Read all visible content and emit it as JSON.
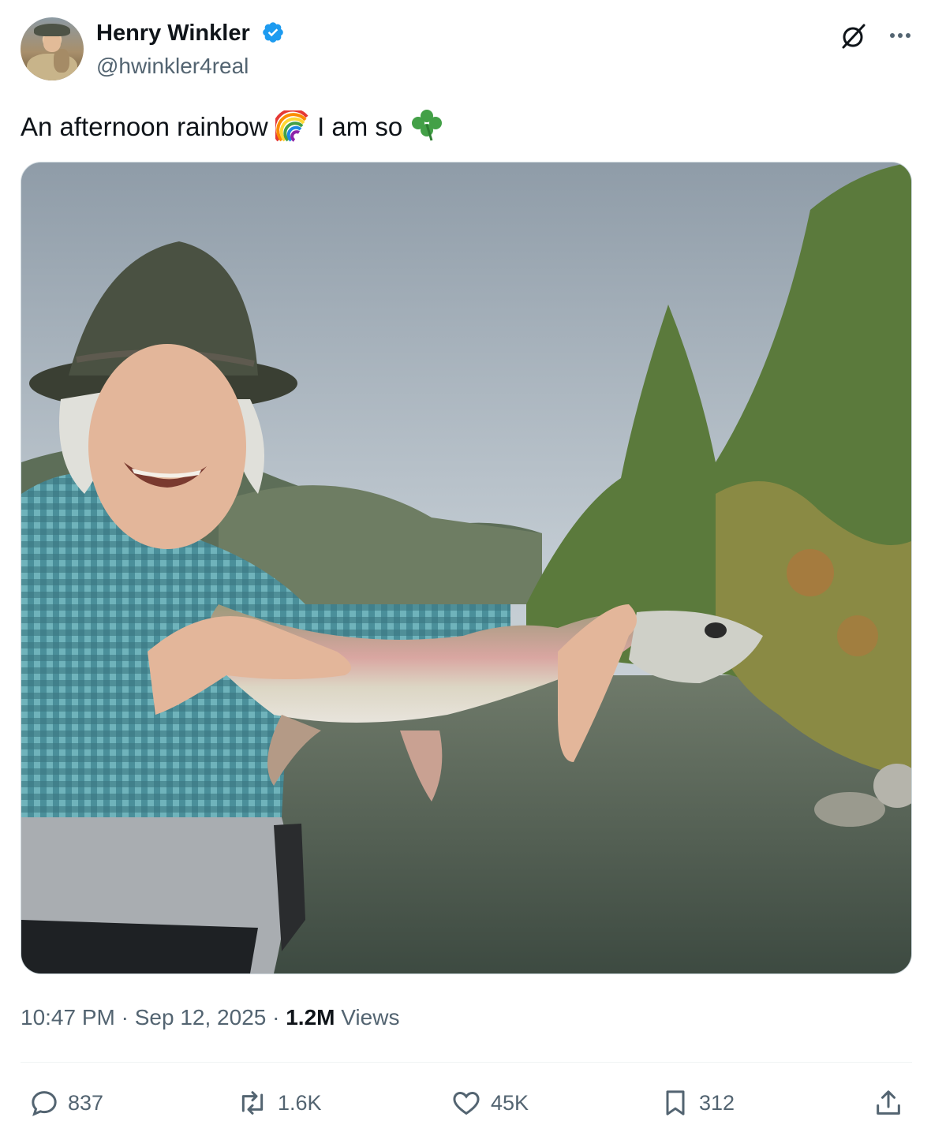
{
  "author": {
    "name": "Henry Winkler",
    "handle": "@hwinkler4real",
    "avatar_icon": "avatar-photo",
    "verified": true,
    "verified_color": "#1d9bf0"
  },
  "header_icons": {
    "grok": "grok-icon",
    "more": "more-icon"
  },
  "tweet": {
    "text_part1": "An afternoon rainbow",
    "emoji1": "rainbow-emoji",
    "text_part2": "I am so",
    "emoji2": "four-leaf-clover-emoji"
  },
  "media": {
    "icon": "photo-fisherman-holding-rainbow-trout"
  },
  "meta": {
    "time": "10:47 PM",
    "sep1": "·",
    "date": "Sep 12, 2025",
    "sep2": "·",
    "views_count": "1.2M",
    "views_label": "Views"
  },
  "actions": {
    "replies": "837",
    "reposts": "1.6K",
    "likes": "45K",
    "bookmarks": "312"
  },
  "colors": {
    "text": "#0f1419",
    "secondary": "#536471",
    "accent": "#1d9bf0"
  }
}
